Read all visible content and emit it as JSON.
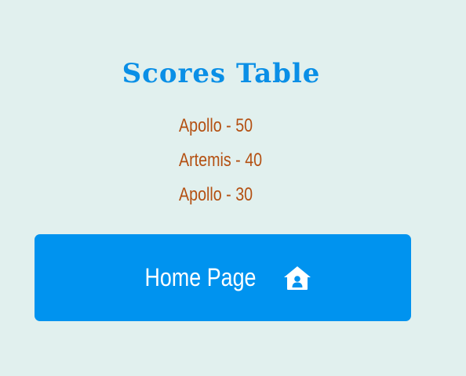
{
  "header": {
    "title": "Scores Table"
  },
  "scores": [
    {
      "text": "Apollo - 50"
    },
    {
      "text": "Artemis - 40"
    },
    {
      "text": "Apollo - 30"
    }
  ],
  "home_button": {
    "label": "Home Page",
    "icon": "home-icon"
  },
  "colors": {
    "background": "#e1f0ee",
    "title": "#0a8fe6",
    "score_text": "#b45012",
    "button": "#0093ef",
    "button_text": "#ffffff"
  }
}
